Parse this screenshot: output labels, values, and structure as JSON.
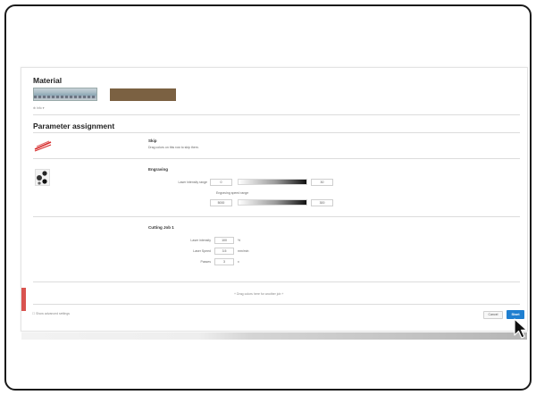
{
  "material": {
    "title": "Material",
    "swatch_colors": [
      "#a9bcc5",
      "#7b6142"
    ],
    "info_link": "⊕ Info ▾"
  },
  "parameters": {
    "title": "Parameter assignment",
    "skip": {
      "icon": "red-laser-lines-icon",
      "title": "Skip",
      "description": "Drag colors on this row to skip them."
    },
    "engraving": {
      "icon": "engraving-image-icon",
      "title": "Engraving",
      "intensity_label": "Laser intensity range",
      "intensity_min": "0",
      "intensity_max": "30",
      "speed_label": "Engraving speed range",
      "speed_min": "5000",
      "speed_max": "300"
    },
    "cutting": {
      "title": "Cutting Job 1",
      "intensity_label": "Laser intensity",
      "intensity_value": "100",
      "intensity_unit": "%",
      "speed_label": "Laser Speed",
      "speed_value": "3.5",
      "speed_unit": "mm/min",
      "passes_label": "Passes",
      "passes_value": "3",
      "passes_unit": "x"
    },
    "drop_hint": "+ Drag colors here for another job +"
  },
  "footer": {
    "advanced_label": "☐ Show advanced settings",
    "cancel_label": "Cancel",
    "next_label": "Start"
  },
  "feedback_label": "Feedback",
  "colors": {
    "accent": "#1f7fd0",
    "feedback": "#d9534f"
  }
}
